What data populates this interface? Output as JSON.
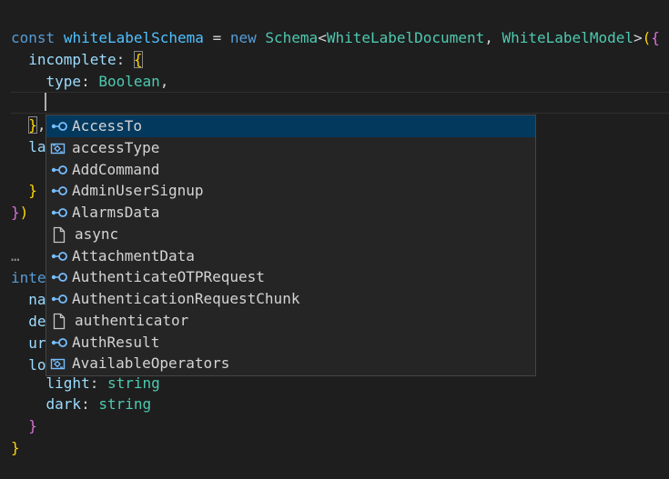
{
  "editor": {
    "lines": {
      "l1": {
        "const": "const",
        "name": "whiteLabelSchema",
        "eq": " = ",
        "new": "new",
        "schema": "Schema",
        "lt": "<",
        "doc": "WhiteLabelDocument",
        "comma": ", ",
        "model": "WhiteLabelModel",
        "gt": ">",
        "paren": "(",
        "brace": "{"
      },
      "l2": {
        "key": "incomplete",
        "colon": ": ",
        "brace": "{"
      },
      "l3": {
        "key": "type",
        "colon": ": ",
        "val": "Boolean",
        "comma": ","
      },
      "l5": {
        "brace": "}",
        "comma": ","
      },
      "l6": {
        "text": "la"
      },
      "l8": {
        "brace": "}"
      },
      "l9": {
        "brace": "}",
        "paren": ")"
      },
      "l11": {
        "text": "…"
      },
      "l12": {
        "text": "inte"
      },
      "l13": {
        "text": "na"
      },
      "l14": {
        "text": "de"
      },
      "l15": {
        "text": "ur"
      },
      "l16": {
        "text": "lo"
      },
      "l17": {
        "key": "light",
        "colon": ": ",
        "type": "string"
      },
      "l18": {
        "key": "dark",
        "colon": ": ",
        "type": "string"
      },
      "l19": {
        "brace": "}"
      },
      "l20": {
        "brace": "}"
      }
    }
  },
  "suggest": {
    "items": [
      {
        "label": "AccessTo",
        "icon": "interface-icon",
        "selected": true
      },
      {
        "label": "accessType",
        "icon": "enum-icon"
      },
      {
        "label": "AddCommand",
        "icon": "interface-icon"
      },
      {
        "label": "AdminUserSignup",
        "icon": "interface-icon"
      },
      {
        "label": "AlarmsData",
        "icon": "interface-icon"
      },
      {
        "label": "async",
        "icon": "file-icon"
      },
      {
        "label": "AttachmentData",
        "icon": "interface-icon"
      },
      {
        "label": "AuthenticateOTPRequest",
        "icon": "interface-icon"
      },
      {
        "label": "AuthenticationRequestChunk",
        "icon": "interface-icon"
      },
      {
        "label": "authenticator",
        "icon": "file-icon"
      },
      {
        "label": "AuthResult",
        "icon": "interface-icon"
      },
      {
        "label": "AvailableOperators",
        "icon": "enum-icon"
      }
    ]
  }
}
